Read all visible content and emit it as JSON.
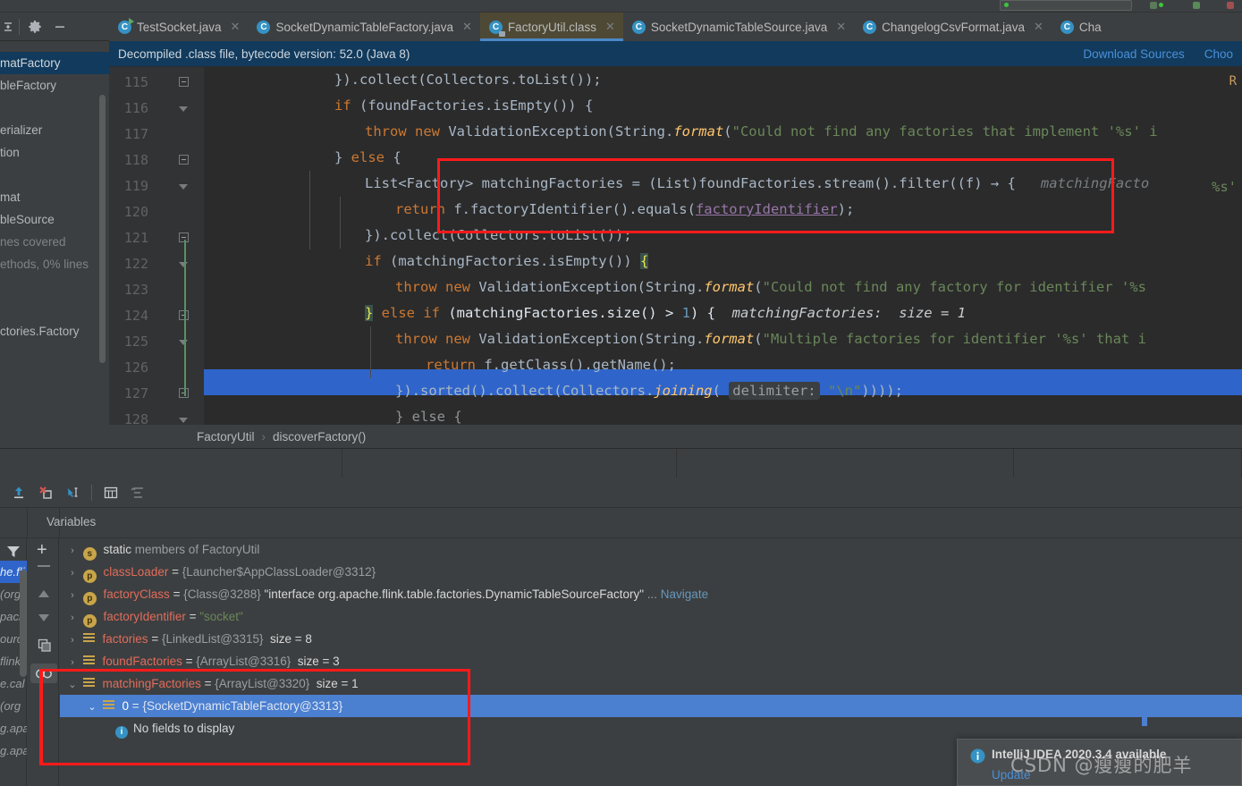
{
  "window": {
    "toolbar_icons": [
      "collapse-all-icon",
      "settings-gear-icon",
      "hide-icon"
    ]
  },
  "tabs": [
    {
      "label": "TestSocket.java",
      "icon": "java-class-run-icon",
      "active": false
    },
    {
      "label": "SocketDynamicTableFactory.java",
      "icon": "java-class-icon",
      "active": false
    },
    {
      "label": "FactoryUtil.class",
      "icon": "java-class-lock-icon",
      "active": true
    },
    {
      "label": "SocketDynamicTableSource.java",
      "icon": "java-class-icon",
      "active": false
    },
    {
      "label": "ChangelogCsvFormat.java",
      "icon": "java-class-icon",
      "active": false
    },
    {
      "label": "Cha",
      "icon": "java-class-icon",
      "active": false
    }
  ],
  "banner": {
    "message": "Decompiled .class file, bytecode version: 52.0 (Java 8)",
    "download_sources": "Download Sources",
    "choose_sources": "Choo"
  },
  "project_sliver": {
    "rows": [
      {
        "text": "matFactory",
        "selected": true
      },
      {
        "text": "bleFactory",
        "selected": false
      },
      {
        "text": "",
        "selected": false
      },
      {
        "text": "erializer",
        "selected": false
      },
      {
        "text": "tion",
        "selected": false
      },
      {
        "text": "",
        "selected": false
      },
      {
        "text": "mat",
        "selected": false
      },
      {
        "text": "bleSource",
        "selected": false
      },
      {
        "text": "nes covered",
        "dim": true
      },
      {
        "text": "ethods, 0% lines",
        "dim": true
      },
      {
        "text": "",
        "selected": false
      },
      {
        "text": "",
        "selected": false
      },
      {
        "text": "ctories.Factory",
        "selected": false
      }
    ]
  },
  "editor": {
    "first_line": 115,
    "lines": [
      {
        "n": 115,
        "fold": "box"
      },
      {
        "n": 116,
        "fold": "tri"
      },
      {
        "n": 117,
        "fold": null
      },
      {
        "n": 118,
        "fold": "box"
      },
      {
        "n": 119,
        "fold": "tri"
      },
      {
        "n": 120,
        "fold": null
      },
      {
        "n": 121,
        "fold": "box"
      },
      {
        "n": 122,
        "fold": "tri"
      },
      {
        "n": 123,
        "fold": null
      },
      {
        "n": 124,
        "fold": "box"
      },
      {
        "n": 125,
        "fold": "tri"
      },
      {
        "n": 126,
        "fold": null
      },
      {
        "n": 127,
        "fold": "box"
      },
      {
        "n": 128,
        "fold": "tri"
      }
    ],
    "code": {
      "l115": "}).collect(Collectors.toList());",
      "l116_kw": "if",
      "l116_rest": " (foundFactories.isEmpty()) {",
      "l117_throw": "throw new",
      "l117_a": " ValidationException(String.",
      "l117_fmt": "format",
      "l117_str": "\"Could not find any factories that implement '%s' i",
      "l118": "} else {",
      "l119_type": "List<Factory> ",
      "l119_rest": "matchingFactories = (List)foundFactories.stream().filter((f) → {",
      "l119_hint": "matchingFacto",
      "l120_kw": "return",
      "l120_a": " f.factoryIdentifier().equals(",
      "l120_stc": "factoryIdentifier",
      "l120_b": ");",
      "l121": "}).collect(Collectors.toList());",
      "l122_kw": "if",
      "l122_rest": " (matchingFactories.isEmpty()) ",
      "l122_brace": "{",
      "l123_throw": "throw new",
      "l123_a": " ValidationException(String.",
      "l123_fmt": "format",
      "l123_str": "\"Could not find any factory for identifier '%s",
      "l124_brace": "}",
      "l124_kw": " else if",
      "l124_rest": " (matchingFactories.size() > ",
      "l124_num": "1",
      "l124_end": ") {",
      "l124_hint_name": "matchingFactories:",
      "l124_hint_val": "size = 1",
      "l125_throw": "throw new",
      "l125_a": " ValidationException(String.",
      "l125_fmt": "format",
      "l125_str": "\"Multiple factories for identifier '%s' that i",
      "l126_kw": "return",
      "l126_rest": " f.getClass().getName();",
      "l127_a": "}).sorted().collect(Collectors.",
      "l127_fmt": "joining",
      "l127_chip": "delimiter:",
      "l127_str": "\"\\n\"",
      "l127_end": "))));",
      "l128": "} else {",
      "right_marker_top": "R",
      "right_marker_mid": "%s'"
    }
  },
  "breadcrumb": {
    "left_stub": "",
    "class": "FactoryUtil",
    "separator": "›",
    "method": "discoverFactory()"
  },
  "debug_toolbar": {
    "icons": [
      "step-out-icon",
      "force-step-into-icon",
      "step-into-icon",
      "evaluate-expression-icon",
      "sort-variables-icon"
    ]
  },
  "variables_panel": {
    "title": "Variables",
    "filter_icon": "filter-icon",
    "side_buttons": [
      "add-watch-icon",
      "remove-watch-icon",
      "move-up-icon",
      "move-down-icon",
      "copy-icon",
      "watches-icon"
    ],
    "frames_sliver": [
      {
        "text": "he.fli",
        "selected": true
      },
      {
        "text": "(org.",
        "selected": false
      },
      {
        "text": "pache",
        "selected": false
      },
      {
        "text": "ource",
        "selected": false
      },
      {
        "text": " flink",
        "selected": false
      },
      {
        "text": "e.cal",
        "selected": false
      },
      {
        "text": " (org",
        "selected": false
      },
      {
        "text": "g.apa",
        "selected": false
      },
      {
        "text": "g.apa",
        "selected": false
      }
    ],
    "rows": [
      {
        "indent": 0,
        "arrow": "›",
        "icon": "static-badge",
        "badge": "s",
        "name": "static",
        "name_class": "static",
        "rest": " members of FactoryUtil",
        "selected": false
      },
      {
        "indent": 0,
        "arrow": "›",
        "icon": "parameter-badge",
        "badge": "p",
        "name": "classLoader",
        "name_class": "var",
        "eq": " = ",
        "value": "{Launcher$AppClassLoader@3312}",
        "selected": false
      },
      {
        "indent": 0,
        "arrow": "›",
        "icon": "parameter-badge",
        "badge": "p",
        "name": "factoryClass",
        "name_class": "var",
        "eq": " = ",
        "value": "{Class@3288}",
        "value2": "\"interface org.apache.flink.table.factories.DynamicTableSourceFactory\"",
        "ellipsis": " ... ",
        "link": "Navigate",
        "selected": false
      },
      {
        "indent": 0,
        "arrow": "›",
        "icon": "parameter-badge",
        "badge": "p",
        "name": "factoryIdentifier",
        "name_class": "var",
        "eq": " = ",
        "str_value": "\"socket\"",
        "selected": false
      },
      {
        "indent": 0,
        "arrow": "›",
        "icon": "list-icon",
        "name": "factories",
        "name_class": "var",
        "eq": " = ",
        "value": "{LinkedList@3315}",
        "size": "size = 8",
        "selected": false
      },
      {
        "indent": 0,
        "arrow": "›",
        "icon": "list-icon",
        "name": "foundFactories",
        "name_class": "var",
        "eq": " = ",
        "value": "{ArrayList@3316}",
        "size": "size = 3",
        "selected": false
      },
      {
        "indent": 0,
        "arrow": "⌄",
        "icon": "list-icon",
        "name": "matchingFactories",
        "name_class": "var",
        "eq": " = ",
        "value": "{ArrayList@3320}",
        "size": "size = 1",
        "selected": false
      },
      {
        "indent": 1,
        "arrow": "⌄",
        "icon": "list-icon",
        "name": "0",
        "name_class": "plain",
        "eq": " = ",
        "value": "{SocketDynamicTableFactory@3313}",
        "selected": true
      },
      {
        "indent": 2,
        "arrow": "",
        "icon": "info-icon",
        "name": "",
        "name_class": "plain",
        "plain_text": "No fields to display",
        "selected": false
      }
    ]
  },
  "notification": {
    "icon": "info-icon",
    "title": "IntelliJ IDEA 2020.3.4 available",
    "action": "Update"
  },
  "watermark": "CSDN @瘦瘦的肥羊",
  "colors": {
    "accent_blue": "#4a88c7",
    "selection_blue": "#2f65ca",
    "annotation_red": "#ff1a1a",
    "banner_bg": "#113a5c",
    "editor_bg": "#2b2b2b",
    "panel_bg": "#3c3f41"
  }
}
